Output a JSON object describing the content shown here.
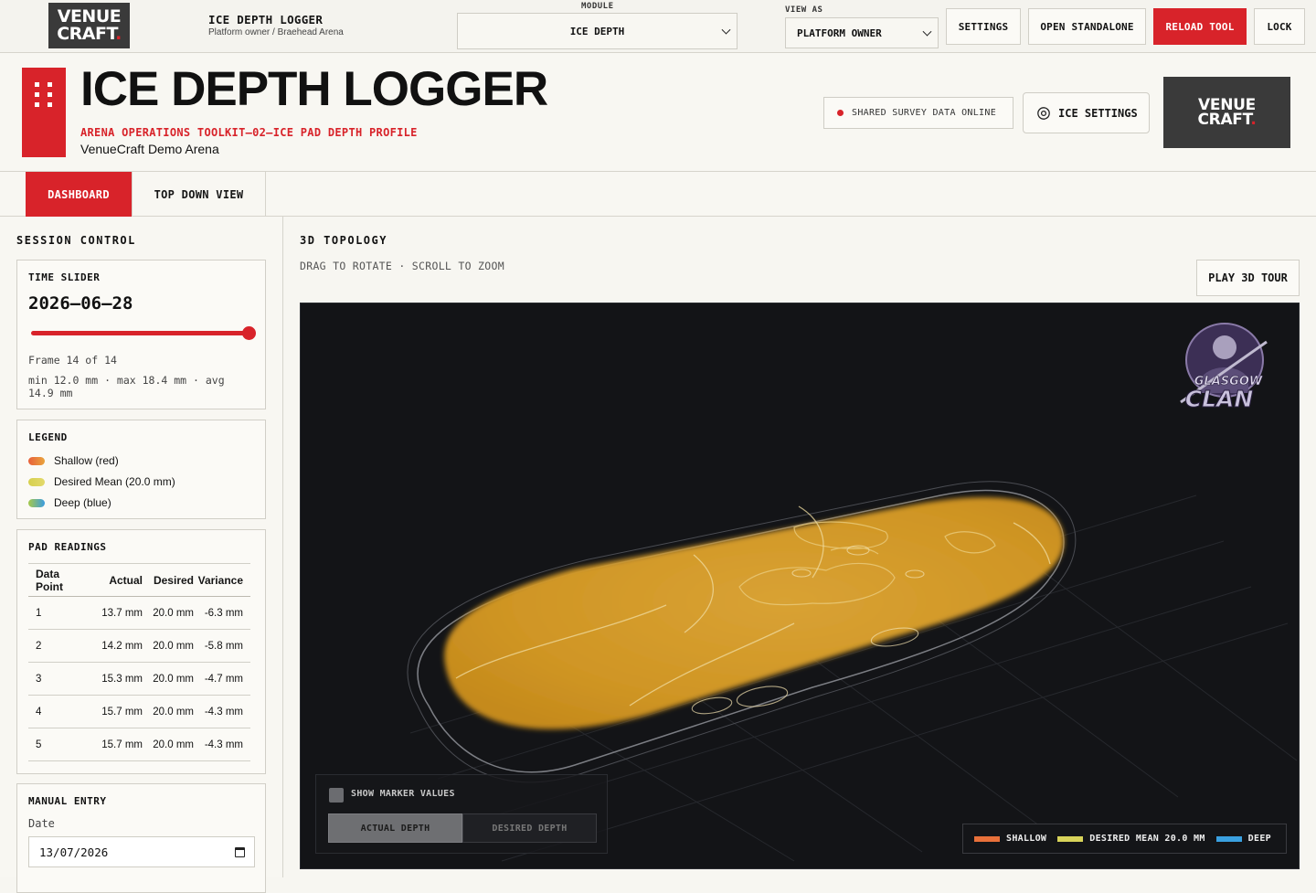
{
  "topbar": {
    "logo_line1": "VENUE",
    "logo_line2": "CRAFT",
    "logo_dot": ".",
    "app_title": "ICE DEPTH LOGGER",
    "app_subtitle": "Platform owner / Braehead Arena",
    "module_label": "MODULE",
    "module_value": "ICE DEPTH",
    "view_as_label": "VIEW AS",
    "view_as_value": "PLATFORM OWNER",
    "buttons": {
      "settings": "SETTINGS",
      "open_standalone": "OPEN STANDALONE",
      "reload_tool": "RELOAD TOOL",
      "lock": "LOCK"
    }
  },
  "header": {
    "title": "ICE DEPTH LOGGER",
    "subtitle": "ARENA OPERATIONS TOOLKIT—02—ICE PAD DEPTH PROFILE",
    "arena": "VenueCraft Demo Arena",
    "status_pill": "SHARED SURVEY DATA ONLINE",
    "ice_settings": "ICE SETTINGS",
    "logo_line1": "VENUE",
    "logo_line2": "CRAFT"
  },
  "tabs": [
    {
      "label": "DASHBOARD",
      "active": true
    },
    {
      "label": "TOP DOWN VIEW",
      "active": false
    }
  ],
  "sidebar": {
    "section_title": "SESSION CONTROL",
    "time_slider": {
      "title": "TIME SLIDER",
      "date": "2026–06–28",
      "position_fraction": 1.0,
      "frame_text": "Frame 14 of 14",
      "stats_text": "min 12.0 mm · max 18.4 mm · avg 14.9 mm"
    },
    "legend": {
      "title": "LEGEND",
      "items": [
        {
          "label": "Shallow (red)",
          "color_from": "#e8603a",
          "color_to": "#e9a43c"
        },
        {
          "label": "Desired Mean (20.0 mm)",
          "color_from": "#d6d04e",
          "color_to": "#e3d96b"
        },
        {
          "label": "Deep (blue)",
          "color_from": "#a6c94a",
          "color_to": "#3a9be0"
        }
      ]
    },
    "pad_readings": {
      "title": "PAD READINGS",
      "columns": [
        "Data Point",
        "Actual",
        "Desired",
        "Variance"
      ],
      "rows": [
        [
          "1",
          "13.7 mm",
          "20.0 mm",
          "-6.3 mm"
        ],
        [
          "2",
          "14.2 mm",
          "20.0 mm",
          "-5.8 mm"
        ],
        [
          "3",
          "15.3 mm",
          "20.0 mm",
          "-4.7 mm"
        ],
        [
          "4",
          "15.7 mm",
          "20.0 mm",
          "-4.3 mm"
        ],
        [
          "5",
          "15.7 mm",
          "20.0 mm",
          "-4.3 mm"
        ]
      ]
    },
    "manual_entry": {
      "title": "MANUAL ENTRY",
      "date_label": "Date",
      "date_value": "13/07/2026"
    }
  },
  "main": {
    "section_title": "3D TOPOLOGY",
    "hint": "DRAG TO ROTATE · SCROLL TO ZOOM",
    "play_tour": "PLAY 3D TOUR",
    "team_logo_line1": "GLASGOW",
    "team_logo_line2": "CLAN",
    "show_marker_values": "SHOW MARKER VALUES",
    "show_marker_checked": false,
    "segments": [
      "ACTUAL DEPTH",
      "DESIRED DEPTH"
    ],
    "active_segment": "ACTUAL DEPTH",
    "legend": [
      {
        "label": "SHALLOW",
        "color": "#e8703a"
      },
      {
        "label": "DESIRED MEAN 20.0 MM",
        "color": "#d8d35a"
      },
      {
        "label": "DEEP",
        "color": "#3aa0e0"
      }
    ]
  },
  "colors": {
    "accent_red": "#d8232a",
    "ice_surface": "#d79a2c",
    "viewport_bg": "#131417"
  }
}
